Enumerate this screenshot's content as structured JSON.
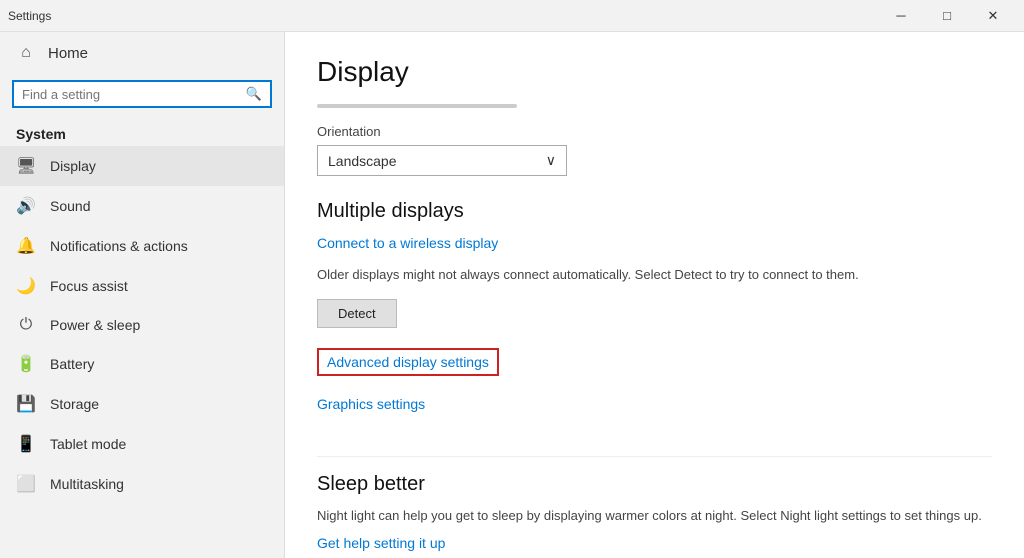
{
  "titlebar": {
    "title": "Settings",
    "minimize_label": "─",
    "restore_label": "□",
    "close_label": "✕"
  },
  "sidebar": {
    "home_label": "Home",
    "search_placeholder": "Find a setting",
    "search_icon": "🔍",
    "section_label": "System",
    "items": [
      {
        "id": "display",
        "label": "Display",
        "icon": "🖥"
      },
      {
        "id": "sound",
        "label": "Sound",
        "icon": "🔊"
      },
      {
        "id": "notifications",
        "label": "Notifications & actions",
        "icon": "🔔"
      },
      {
        "id": "focus",
        "label": "Focus assist",
        "icon": "🌙"
      },
      {
        "id": "power",
        "label": "Power & sleep",
        "icon": "⏻"
      },
      {
        "id": "battery",
        "label": "Battery",
        "icon": "🔋"
      },
      {
        "id": "storage",
        "label": "Storage",
        "icon": "💾"
      },
      {
        "id": "tablet",
        "label": "Tablet mode",
        "icon": "📱"
      },
      {
        "id": "multitasking",
        "label": "Multitasking",
        "icon": "⬜"
      }
    ]
  },
  "content": {
    "page_title": "Display",
    "orientation_label": "Orientation",
    "orientation_value": "Landscape",
    "multiple_displays_heading": "Multiple displays",
    "connect_wireless_link": "Connect to a wireless display",
    "detect_description": "Older displays might not always connect automatically. Select Detect to try to connect to them.",
    "detect_button_label": "Detect",
    "advanced_display_link": "Advanced display settings",
    "graphics_settings_link": "Graphics settings",
    "sleep_heading": "Sleep better",
    "sleep_description": "Night light can help you get to sleep by displaying warmer colors at night. Select Night light settings to set things up.",
    "night_light_link": "Get help setting it up"
  }
}
